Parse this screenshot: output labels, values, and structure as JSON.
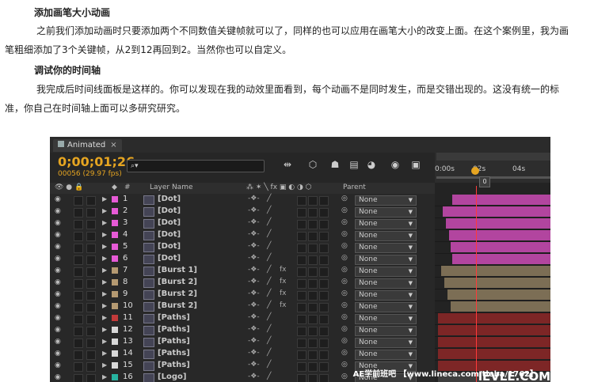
{
  "article": {
    "heading1": "添加画笔大小动画",
    "para1_line1": "之前我们添加动画时只要添加两个不同数值关键帧就可以了，同样的也可以应用在画笔大小的改变上面。在这个案例里，我为画",
    "para1_line2": "笔粗细添加了3个关键帧，从2到12再回到2。当然你也可以自定义。",
    "heading2": "调试你的时间轴",
    "para2_line1": "我完成后时间线面板是这样的。你可以发现在我的动效里面看到，每个动画不是同时发生，而是交错出现的。这没有统一的标",
    "para2_line2": "准，你自己在时间轴上面可以多研究研究。"
  },
  "panel": {
    "tab_label": "Animated",
    "tab_close": "×",
    "timecode": "0;00;01;26",
    "frame_info": "00056 (29.97 fps)",
    "search_placeholder": "",
    "search_icon": "magnifier-icon",
    "ruler_labels": [
      "0:00s",
      "02s",
      "04s"
    ],
    "playhead_tag": "0",
    "header": {
      "number": "#",
      "layer_name": "Layer Name",
      "parent": "Parent"
    },
    "layers": [
      {
        "num": "1",
        "name": "[Dot]",
        "label_color": "#e65ad6",
        "bar_color": "#b2459f",
        "fx": "",
        "parent": "None"
      },
      {
        "num": "2",
        "name": "[Dot]",
        "label_color": "#e65ad6",
        "bar_color": "#b2459f",
        "fx": "",
        "parent": "None"
      },
      {
        "num": "3",
        "name": "[Dot]",
        "label_color": "#e65ad6",
        "bar_color": "#b2459f",
        "fx": "",
        "parent": "None"
      },
      {
        "num": "4",
        "name": "[Dot]",
        "label_color": "#e65ad6",
        "bar_color": "#b2459f",
        "fx": "",
        "parent": "None"
      },
      {
        "num": "5",
        "name": "[Dot]",
        "label_color": "#e65ad6",
        "bar_color": "#b2459f",
        "fx": "",
        "parent": "None"
      },
      {
        "num": "6",
        "name": "[Dot]",
        "label_color": "#e65ad6",
        "bar_color": "#b2459f",
        "fx": "",
        "parent": "None"
      },
      {
        "num": "7",
        "name": "[Burst 1]",
        "label_color": "#b59a72",
        "bar_color": "#7c6e55",
        "fx": "fx",
        "parent": "None"
      },
      {
        "num": "8",
        "name": "[Burst 2]",
        "label_color": "#b59a72",
        "bar_color": "#7c6e55",
        "fx": "fx",
        "parent": "None"
      },
      {
        "num": "9",
        "name": "[Burst 2]",
        "label_color": "#b59a72",
        "bar_color": "#7c6e55",
        "fx": "fx",
        "parent": "None"
      },
      {
        "num": "10",
        "name": "[Burst 2]",
        "label_color": "#b59a72",
        "bar_color": "#7c6e55",
        "fx": "fx",
        "parent": "None"
      },
      {
        "num": "11",
        "name": "[Paths]",
        "label_color": "#c23a3a",
        "bar_color": "#7d2626",
        "fx": "",
        "parent": "None"
      },
      {
        "num": "12",
        "name": "[Paths]",
        "label_color": "#d8d8d8",
        "bar_color": "#7d2626",
        "fx": "",
        "parent": "None"
      },
      {
        "num": "13",
        "name": "[Paths]",
        "label_color": "#d8d8d8",
        "bar_color": "#7d2626",
        "fx": "",
        "parent": "None"
      },
      {
        "num": "14",
        "name": "[Paths]",
        "label_color": "#d8d8d8",
        "bar_color": "#7d2626",
        "fx": "",
        "parent": "None"
      },
      {
        "num": "15",
        "name": "[Paths]",
        "label_color": "#d8d8d8",
        "bar_color": "#7d2626",
        "fx": "",
        "parent": "None"
      },
      {
        "num": "16",
        "name": "[Logo]",
        "label_color": "#27b3a0",
        "bar_color": "#3e3e3e",
        "fx": "",
        "parent": "None"
      }
    ],
    "watermark": "AE学前班吧 【www.lineca.com/tieba/1762】",
    "watermark2": "lEVLE.COM"
  }
}
